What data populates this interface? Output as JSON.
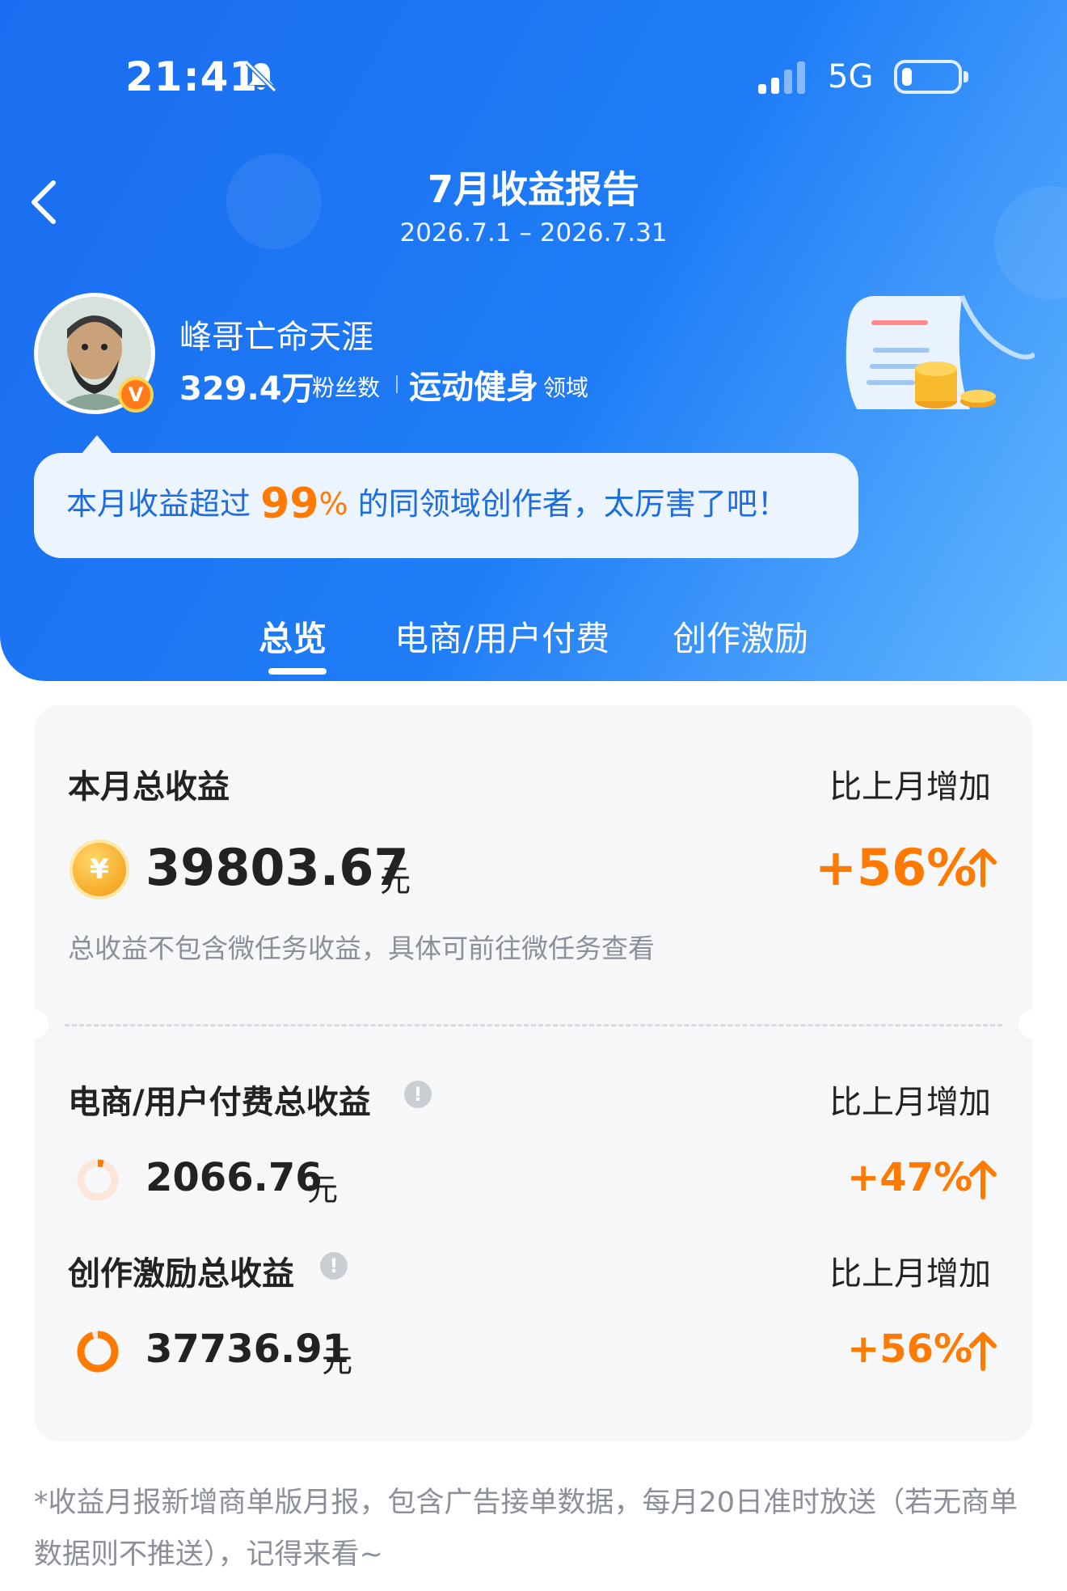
{
  "status_bar": {
    "time": "21:41",
    "network": "5G"
  },
  "header": {
    "title": "7月收益报告",
    "date_range": "2026.7.1 – 2026.7.31",
    "user": {
      "name": "峰哥亡命天涯",
      "followers_value": "329.4万",
      "followers_label": "粉丝数",
      "domain_value": "运动健身",
      "domain_label": "领域",
      "badge": "V"
    },
    "bubble": {
      "prefix": "本月收益超过",
      "percent": "99",
      "percent_sign": "%",
      "suffix": "的同领域创作者，太厉害了吧！"
    },
    "tabs": [
      {
        "label": "总览",
        "active": true
      },
      {
        "label": "电商/用户付费",
        "active": false
      },
      {
        "label": "创作激励",
        "active": false
      }
    ]
  },
  "summary": {
    "total": {
      "label": "本月总收益",
      "compare_label": "比上月增加",
      "coin_symbol": "¥",
      "value": "39803.67",
      "unit": "元",
      "change": "+56%",
      "note": "总收益不包含微任务收益，具体可前往微任务查看"
    },
    "ecommerce": {
      "label": "电商/用户付费总收益",
      "compare_label": "比上月增加",
      "value": "2066.76",
      "unit": "元",
      "change": "+47%",
      "share": 0.05
    },
    "incentive": {
      "label": "创作激励总收益",
      "compare_label": "比上月增加",
      "value": "37736.91",
      "unit": "元",
      "change": "+56%",
      "share": 0.95
    },
    "info_icon": "!"
  },
  "footer": {
    "note": "*收益月报新增商单版月报，包含广告接单数据，每月20日准时放送（若无商单数据则不推送），记得来看~"
  },
  "colors": {
    "accent": "#ff7a00",
    "header_blue": "#1f7cf6",
    "bubble_text": "#1d6ce0"
  }
}
